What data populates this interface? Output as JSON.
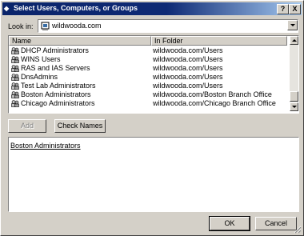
{
  "window": {
    "title": "Select Users, Computers, or Groups",
    "help_button": "?",
    "close_button": "X"
  },
  "lookin": {
    "label": "Look in:",
    "value": "wildwooda.com"
  },
  "list": {
    "columns": [
      "Name",
      "In Folder"
    ],
    "rows": [
      {
        "name": "DHCP Administrators",
        "folder": "wildwooda.com/Users"
      },
      {
        "name": "WINS Users",
        "folder": "wildwooda.com/Users"
      },
      {
        "name": "RAS and IAS Servers",
        "folder": "wildwooda.com/Users"
      },
      {
        "name": "DnsAdmins",
        "folder": "wildwooda.com/Users"
      },
      {
        "name": "Test Lab Administrators",
        "folder": "wildwooda.com/Users"
      },
      {
        "name": "Boston Administrators",
        "folder": "wildwooda.com/Boston Branch Office"
      },
      {
        "name": "Chicago Administrators",
        "folder": "wildwooda.com/Chicago Branch Office"
      }
    ]
  },
  "buttons": {
    "add": "Add",
    "check_names": "Check Names",
    "ok": "OK",
    "cancel": "Cancel"
  },
  "selected": {
    "items": [
      "Boston Administrators"
    ]
  },
  "colors": {
    "title_bar": "#0a246a",
    "face": "#d4d0c8"
  },
  "icons": {
    "row_icon": "group-icon",
    "domain_icon": "domain-icon"
  }
}
